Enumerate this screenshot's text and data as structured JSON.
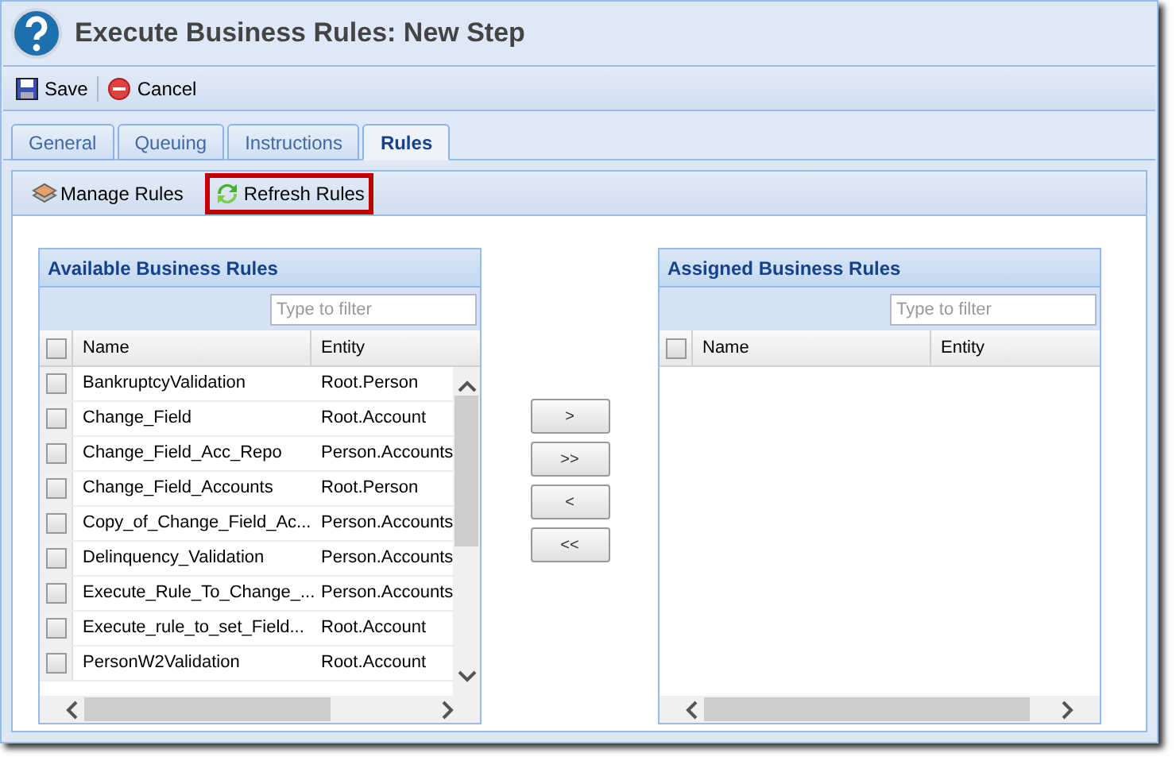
{
  "window": {
    "title": "Execute Business Rules: New Step"
  },
  "toolbar": [
    {
      "label": "Save",
      "kind": "save"
    },
    {
      "label": "Cancel",
      "kind": "cancel"
    }
  ],
  "tabs": [
    {
      "label": "General",
      "selected": false
    },
    {
      "label": "Queuing",
      "selected": false
    },
    {
      "label": "Instructions",
      "selected": false
    },
    {
      "label": "Rules",
      "selected": true
    }
  ],
  "rules_toolbar": [
    {
      "label": "Manage Rules",
      "kind": "manage",
      "highlighted": false
    },
    {
      "label": "Refresh Rules",
      "kind": "refresh",
      "highlighted": true
    }
  ],
  "available": {
    "title": "Available Business Rules",
    "filter": {
      "placeholder": "Type to filter"
    },
    "select_all_checked": false,
    "columns": [
      "Name",
      "Entity"
    ],
    "rows": [
      {
        "name": "BankruptcyValidation",
        "entity": "Root.Person",
        "checked": false
      },
      {
        "name": "Change_Field",
        "entity": "Root.Account",
        "checked": false
      },
      {
        "name": "Change_Field_Acc_Repo",
        "entity": "Person.Accounts",
        "checked": false
      },
      {
        "name": "Change_Field_Accounts",
        "entity": "Root.Person",
        "checked": false
      },
      {
        "name": "Copy_of_Change_Field_Ac...",
        "entity": "Person.Accounts",
        "checked": false
      },
      {
        "name": "Delinquency_Validation",
        "entity": "Person.Accounts",
        "checked": false
      },
      {
        "name": "Execute_Rule_To_Change_...",
        "entity": "Person.Accounts",
        "checked": false
      },
      {
        "name": "Execute_rule_to_set_Field...",
        "entity": "Root.Account",
        "checked": false
      },
      {
        "name": "PersonW2Validation",
        "entity": "Root.Account",
        "checked": false
      }
    ]
  },
  "move_buttons": [
    ">",
    ">>",
    "<",
    "<<"
  ],
  "assigned": {
    "title": "Assigned Business Rules",
    "filter": {
      "placeholder": "Type to filter"
    },
    "select_all_checked": false,
    "columns": [
      "Name",
      "Entity"
    ]
  }
}
